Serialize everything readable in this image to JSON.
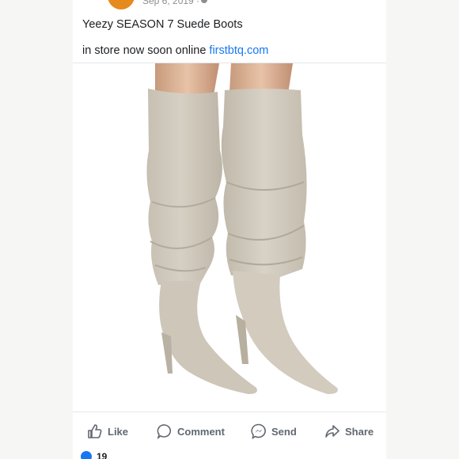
{
  "post": {
    "date": "Sep 6, 2019 ·",
    "title_line": "Yeezy SEASON 7 Suede Boots",
    "body_prefix": "in store now soon online",
    "link_text": "firstbtq.com"
  },
  "actions": {
    "like": "Like",
    "comment": "Comment",
    "send": "Send",
    "share": "Share"
  },
  "reactions": {
    "count": "19"
  },
  "icons": [
    "thumb-up-icon",
    "comment-icon",
    "messenger-icon",
    "share-icon",
    "globe-icon"
  ],
  "colors": {
    "link": "#1877f2",
    "avatar": "#e58a1c",
    "action_text": "#606770",
    "suede": "#cfc8bb",
    "background": "#f6f6f4"
  }
}
